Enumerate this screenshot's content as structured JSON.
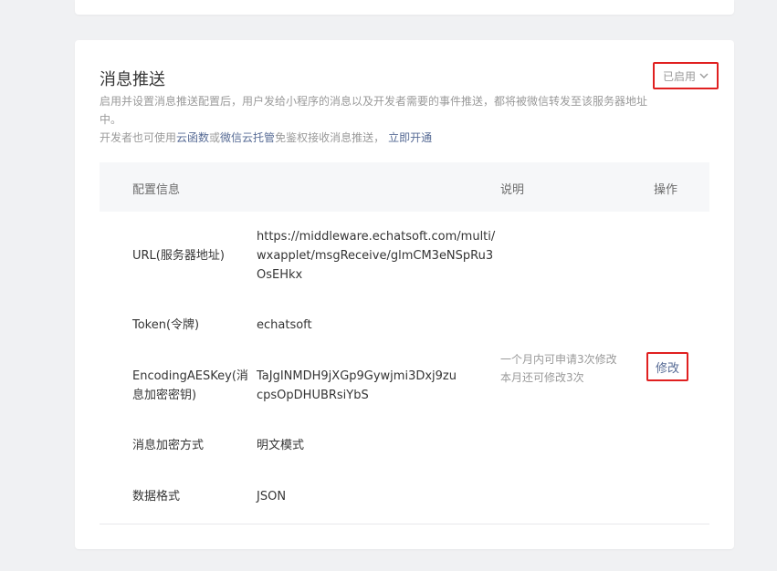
{
  "section": {
    "title": "消息推送",
    "status_label": "已启用",
    "description_line1": "启用并设置消息推送配置后，用户发给小程序的消息以及开发者需要的事件推送，都将被微信转发至该服务器地址中。",
    "description_line2_prefix": "开发者也可使用",
    "description_link1": "云函数",
    "description_or": "或",
    "description_link2": "微信云托管",
    "description_line2_suffix": "免鉴权接收消息推送，",
    "description_action": "立即开通"
  },
  "table": {
    "headers": {
      "config": "配置信息",
      "note": "说明",
      "action": "操作"
    },
    "rows": [
      {
        "label": "URL(服务器地址)",
        "value": "https://middleware.echatsoft.com/multi/wxapplet/msgReceive/glmCM3eNSpRu3OsEHkx"
      },
      {
        "label": "Token(令牌)",
        "value": "echatsoft"
      },
      {
        "label": "EncodingAESKey(消息加密密钥)",
        "value": "TaJgINMDH9jXGp9Gywjmi3Dxj9zucpsOpDHUBRsiYbS"
      },
      {
        "label": "消息加密方式",
        "value": "明文模式"
      },
      {
        "label": "数据格式",
        "value": "JSON"
      }
    ],
    "note_line1": "一个月内可申请3次修改",
    "note_line2": "本月还可修改3次",
    "edit_label": "修改"
  }
}
